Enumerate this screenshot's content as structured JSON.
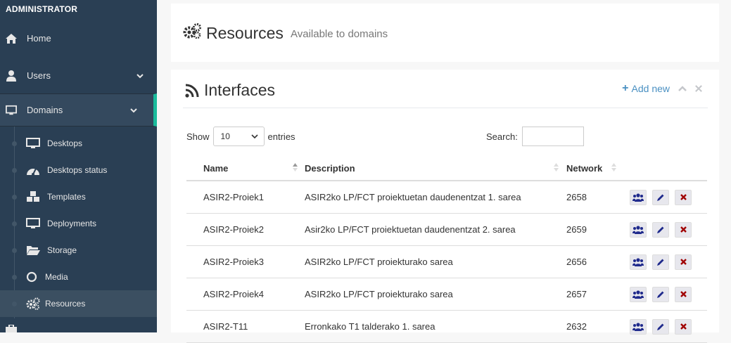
{
  "sidebar": {
    "header": "ADMINISTRATOR",
    "items": [
      {
        "label": "Home"
      },
      {
        "label": "Users"
      },
      {
        "label": "Domains"
      }
    ],
    "submenu": [
      {
        "label": "Desktops"
      },
      {
        "label": "Desktops status"
      },
      {
        "label": "Templates"
      },
      {
        "label": "Deployments"
      },
      {
        "label": "Storage"
      },
      {
        "label": "Media"
      },
      {
        "label": "Resources"
      }
    ]
  },
  "page": {
    "title": "Resources",
    "subtitle": "Available to domains"
  },
  "panel": {
    "title": "Interfaces",
    "add_new": "Add new"
  },
  "table_controls": {
    "show_label": "Show",
    "entries_value": "10",
    "entries_label": "entries",
    "search_label": "Search:",
    "search_value": ""
  },
  "table": {
    "headers": [
      "Name",
      "Description",
      "Network"
    ],
    "rows": [
      {
        "name": "ASIR2-Proiek1",
        "description": "ASIR2ko LP/FCT proiektuetan daudenentzat 1. sarea",
        "network": "2658"
      },
      {
        "name": "ASIR2-Proiek2",
        "description": "Asir2ko LP/FCT proiektuetan daudenentzat 2. sarea",
        "network": "2659"
      },
      {
        "name": "ASIR2-Proiek3",
        "description": "ASIR2ko LP/FCT proiekturako sarea",
        "network": "2656"
      },
      {
        "name": "ASIR2-Proiek4",
        "description": "ASIR2ko LP/FCT proiekturako sarea",
        "network": "2657"
      },
      {
        "name": "ASIR2-T11",
        "description": "Erronkako T1 talderako 1. sarea",
        "network": "2632"
      }
    ]
  },
  "colors": {
    "sidebar_bg": "#2a3f54",
    "accent": "#1abb9c",
    "link": "#4a90c2",
    "action_blue": "#1f2a8c",
    "action_red": "#a00000"
  }
}
